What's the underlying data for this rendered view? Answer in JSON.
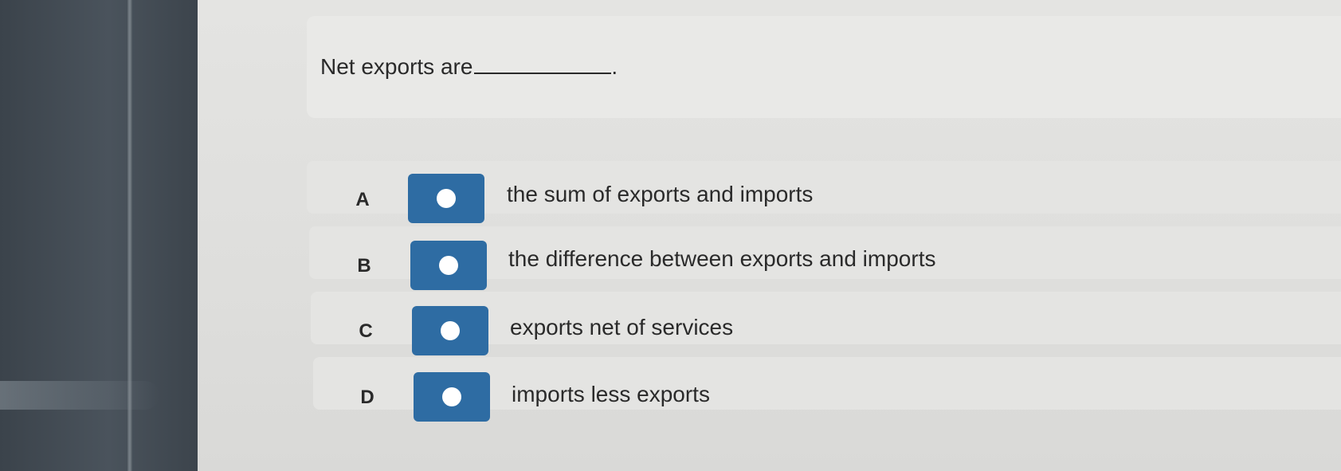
{
  "question": {
    "text": "Net exports are",
    "end_punctuation": "."
  },
  "options": [
    {
      "letter": "A",
      "text": "the sum of exports and imports"
    },
    {
      "letter": "B",
      "text": "the difference between exports and imports"
    },
    {
      "letter": "C",
      "text": "exports net of services"
    },
    {
      "letter": "D",
      "text": "imports less exports"
    }
  ],
  "colors": {
    "radio_button": "#2e6ca3",
    "radio_dot": "#ffffff",
    "text": "#2a2a2a"
  }
}
